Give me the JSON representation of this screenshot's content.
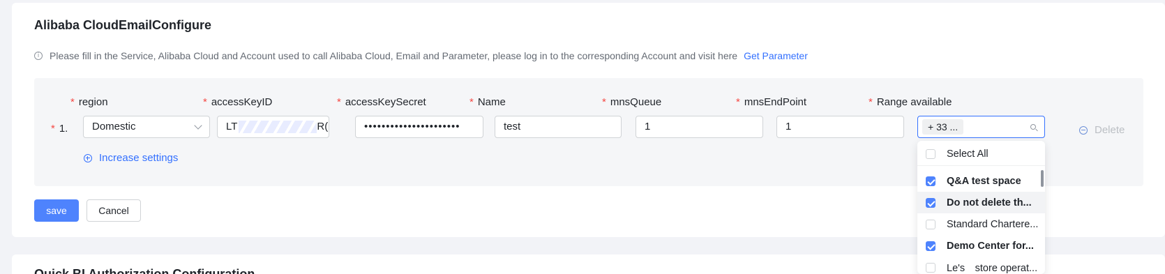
{
  "section_title": "Alibaba CloudEmailConfigure",
  "hint": {
    "text": "Please fill in the Service, Alibaba Cloud and Account used to call Alibaba Cloud, Email and Parameter, please log in to the corresponding Account and visit here",
    "link": "Get Parameter"
  },
  "columns": {
    "region": "region",
    "access_key_id": "accessKeyID",
    "access_key_secret": "accessKeySecret",
    "name": "Name",
    "mns_queue": "mnsQueue",
    "mns_endpoint": "mnsEndPoint",
    "range_available": "Range available"
  },
  "required_mark": "*",
  "row": {
    "index": "1.",
    "region": "Domestic",
    "access_key_id_prefix": "LT",
    "access_key_id_suffix": "R(",
    "access_key_secret": "••••••••••••••••••••••",
    "name": "test",
    "mns_queue": "1",
    "mns_endpoint": "1",
    "range_tag": "+ 33 ...",
    "delete_label": "Delete"
  },
  "add_settings_label": "Increase settings",
  "buttons": {
    "save": "save",
    "cancel": "Cancel"
  },
  "dropdown": {
    "select_all": "Select All",
    "items": [
      {
        "label": "Q&A test space",
        "checked": true
      },
      {
        "label": "Do not delete th...",
        "checked": true
      },
      {
        "label": "Standard Chartere...",
        "checked": false
      },
      {
        "label": "Demo Center for...",
        "checked": true
      },
      {
        "label": "Le's　store operat...",
        "checked": false
      }
    ]
  },
  "next_section_title": "Quick BI Authorization Configuration",
  "colors": {
    "primary": "#4e83fd",
    "link": "#3370ff",
    "required": "#f54a45"
  }
}
